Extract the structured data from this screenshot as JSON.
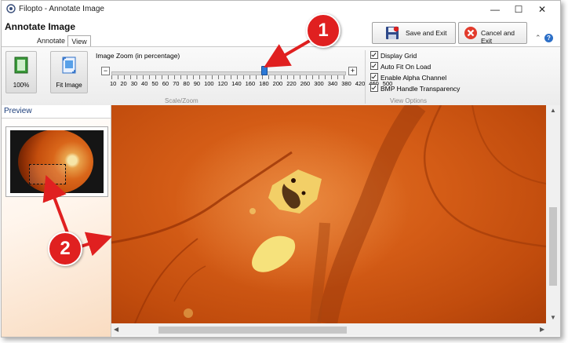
{
  "window": {
    "title": "Filopto - Annotate Image",
    "minimize": "—",
    "maximize": "☐",
    "close": "✕"
  },
  "header": {
    "title": "Annotate Image"
  },
  "tabs": [
    {
      "label": "Annotate",
      "active": false
    },
    {
      "label": "View",
      "active": true
    }
  ],
  "actions": {
    "save_exit": "Save and Exit",
    "cancel_exit": "Cancel and Exit",
    "collapse": "⌃",
    "help": "?"
  },
  "ribbon": {
    "btn_100": "100%",
    "btn_fit": "Fit Image",
    "zoom_label": "Image Zoom (in percentage)",
    "zoom_ticks": [
      "10",
      "20",
      "30",
      "40",
      "50",
      "60",
      "70",
      "80",
      "90",
      "100",
      "120",
      "140",
      "160",
      "180",
      "200",
      "220",
      "260",
      "300",
      "340",
      "380",
      "420",
      "460",
      "500"
    ],
    "minus": "−",
    "plus": "+",
    "scale_group": "Scale/Zoom",
    "view_group": "View Options",
    "options": [
      {
        "label": "Display Grid",
        "checked": true
      },
      {
        "label": "Auto Fit On Load",
        "checked": true
      },
      {
        "label": "Enable Alpha Channel",
        "checked": true
      },
      {
        "label": "BMP Handle Transparency",
        "checked": true
      }
    ]
  },
  "preview": {
    "title": "Preview"
  },
  "scrollbars": {
    "up": "▲",
    "down": "▼",
    "left": "◀",
    "right": "▶"
  },
  "callouts": [
    "1",
    "2"
  ],
  "colors": {
    "callout": "#e02020",
    "accent": "#2c79d6",
    "fundus": "#d45c16"
  }
}
